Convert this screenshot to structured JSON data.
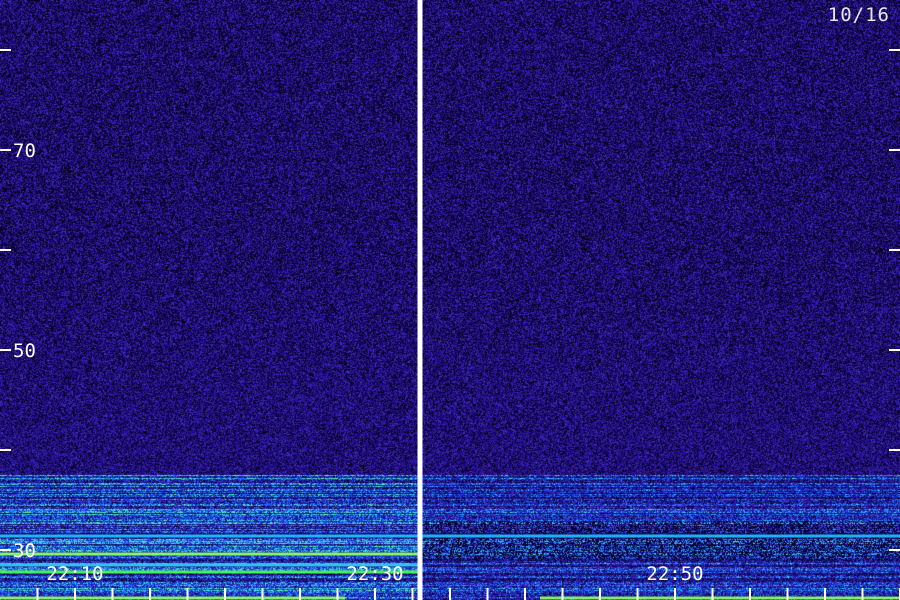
{
  "header": {
    "date": "10/16"
  },
  "chart_data": {
    "type": "heatmap",
    "title": "",
    "xlabel": "",
    "ylabel": "",
    "xlim": [
      "22:05",
      "23:05"
    ],
    "ylim": [
      25,
      85
    ],
    "x_tick_labels": [
      {
        "value": "22:10",
        "minutes": 5
      },
      {
        "value": "22:30",
        "minutes": 25
      },
      {
        "value": "22:50",
        "minutes": 45
      }
    ],
    "x_minor_tick_minutes": [
      2.5,
      5,
      7.5,
      10,
      12.5,
      15,
      17.5,
      20,
      22.5,
      25,
      27.5,
      30,
      32.5,
      35,
      37.5,
      40,
      42.5,
      45,
      47.5,
      50,
      52.5,
      55,
      57.5,
      60
    ],
    "y_ticks": [
      80,
      70,
      60,
      50,
      40,
      30,
      20
    ],
    "y_tick_labels": [
      {
        "value": 70,
        "label": "70"
      },
      {
        "value": 50,
        "label": "50"
      },
      {
        "value": 30,
        "label": "30"
      }
    ],
    "gap_marker_minutes": 28,
    "strong_bands": [
      {
        "freq": 27.8,
        "start_min": 0,
        "end_min": 28,
        "color": "#4aff4a"
      },
      {
        "freq": 28.5,
        "start_min": 0,
        "end_min": 28,
        "color": "#30d0ff"
      },
      {
        "freq": 29.6,
        "start_min": 0,
        "end_min": 28,
        "color": "#8cff5a"
      },
      {
        "freq": 25.2,
        "start_min": 0,
        "end_min": 23,
        "color": "#8cff5a"
      },
      {
        "freq": 25.2,
        "start_min": 36,
        "end_min": 60,
        "color": "#8cff5a"
      },
      {
        "freq": 31.4,
        "start_min": 0,
        "end_min": 60,
        "color": "#20c0ff"
      }
    ],
    "colors": {
      "background_dark": "#0a0020",
      "noise_low": "#24107a",
      "noise_mid": "#3c2cc0",
      "band_blue": "#1e70ff",
      "band_cyan": "#30d0ff",
      "band_green": "#60ff60",
      "axis": "#ffffff"
    }
  }
}
